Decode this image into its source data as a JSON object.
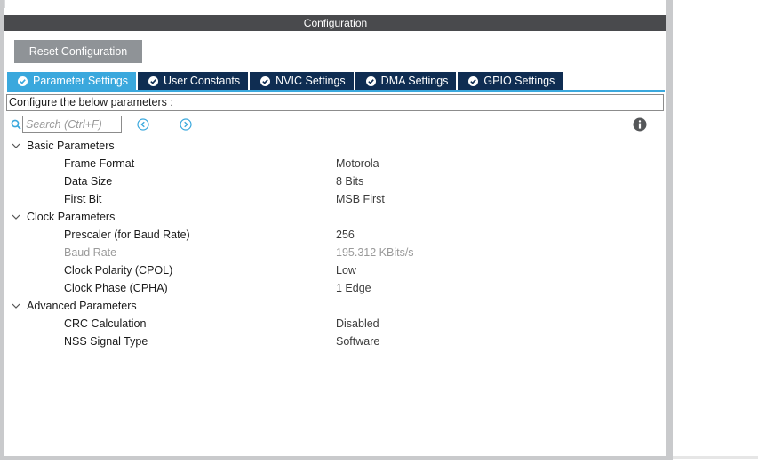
{
  "panel": {
    "title": "Configuration",
    "reset_label": "Reset Configuration"
  },
  "tabs": [
    {
      "label": "Parameter Settings",
      "icon": "check-circle-icon",
      "active": true
    },
    {
      "label": "User Constants",
      "icon": "check-circle-icon",
      "active": false
    },
    {
      "label": "NVIC Settings",
      "icon": "check-circle-icon",
      "active": false
    },
    {
      "label": "DMA Settings",
      "icon": "check-circle-icon",
      "active": false
    },
    {
      "label": "GPIO Settings",
      "icon": "check-circle-icon",
      "active": false
    }
  ],
  "hint": "Configure the below parameters :",
  "search": {
    "placeholder": "Search (Ctrl+F)",
    "value": ""
  },
  "groups": [
    {
      "label": "Basic Parameters",
      "params": [
        {
          "name": "Frame Format",
          "value": "Motorola",
          "disabled": false
        },
        {
          "name": "Data Size",
          "value": "8 Bits",
          "disabled": false
        },
        {
          "name": "First Bit",
          "value": "MSB First",
          "disabled": false
        }
      ]
    },
    {
      "label": "Clock Parameters",
      "params": [
        {
          "name": "Prescaler (for Baud Rate)",
          "value": "256",
          "disabled": false
        },
        {
          "name": "Baud Rate",
          "value": "195.312 KBits/s",
          "disabled": true
        },
        {
          "name": "Clock Polarity (CPOL)",
          "value": "Low",
          "disabled": false
        },
        {
          "name": "Clock Phase (CPHA)",
          "value": "1 Edge",
          "disabled": false
        }
      ]
    },
    {
      "label": "Advanced Parameters",
      "params": [
        {
          "name": "CRC Calculation",
          "value": "Disabled",
          "disabled": false
        },
        {
          "name": "NSS Signal Type",
          "value": "Software",
          "disabled": false
        }
      ]
    }
  ],
  "colors": {
    "header_bg": "#494a4d",
    "tab_bg": "#0f2d52",
    "tab_active_bg": "#3aa8dd",
    "reset_bg": "#8f9397",
    "nav_icon": "#3aa8dd"
  }
}
